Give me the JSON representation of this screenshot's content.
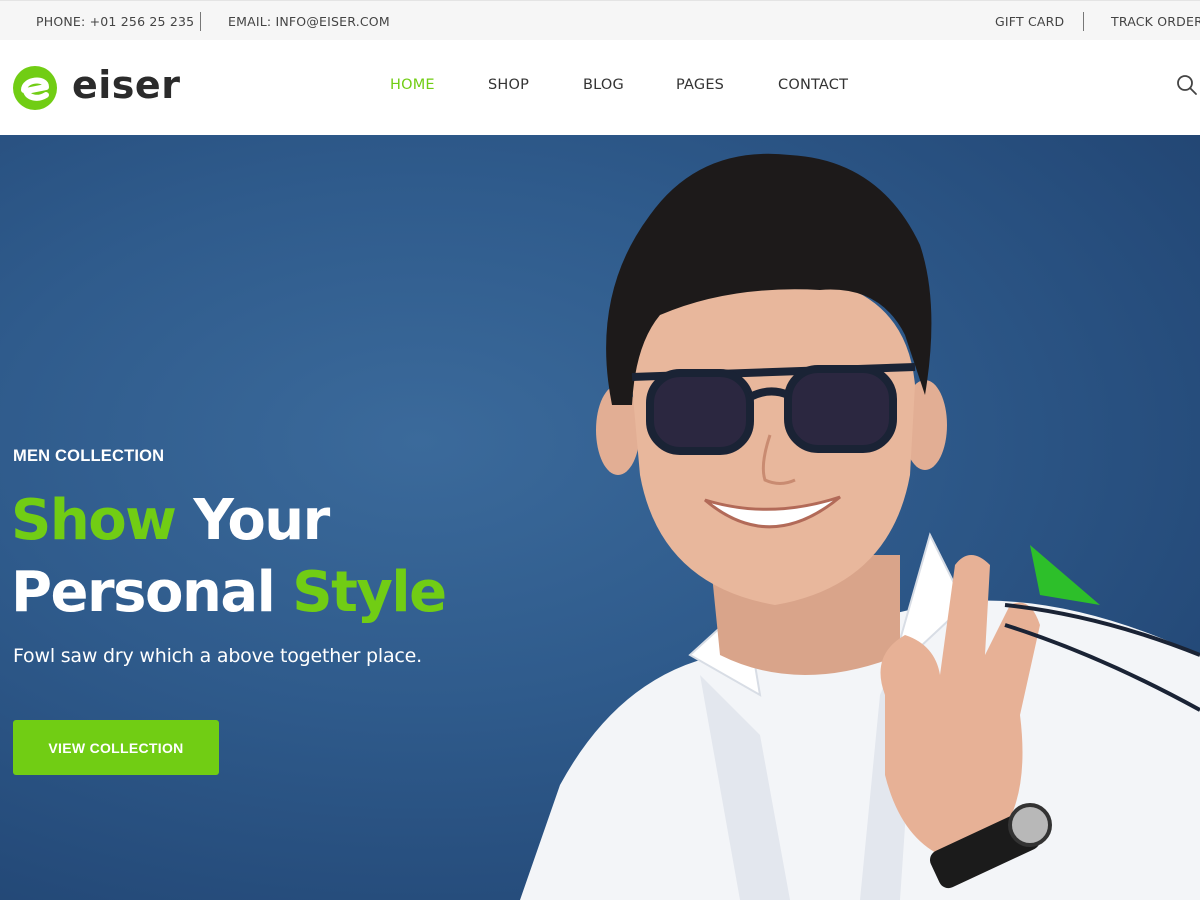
{
  "topbar": {
    "phone": "PHONE: +01 256 25 235",
    "email": "EMAIL: INFO@EISER.COM",
    "gift_card": "GIFT CARD",
    "track_order": "TRACK ORDER"
  },
  "brand": {
    "name": "eiser",
    "accent_color": "#71cd14"
  },
  "nav": {
    "items": [
      "HOME",
      "SHOP",
      "BLOG",
      "PAGES",
      "CONTACT"
    ],
    "active": "HOME"
  },
  "icons": {
    "search": "search-icon",
    "logo": "eiser-logo-mark"
  },
  "hero": {
    "eyebrow": "MEN COLLECTION",
    "headline_1_green": "Show",
    "headline_1_white": "Your",
    "headline_2_white": "Personal",
    "headline_2_green": "Style",
    "subtitle": "Fowl saw dry which a above together place.",
    "cta_label": "VIEW COLLECTION"
  }
}
